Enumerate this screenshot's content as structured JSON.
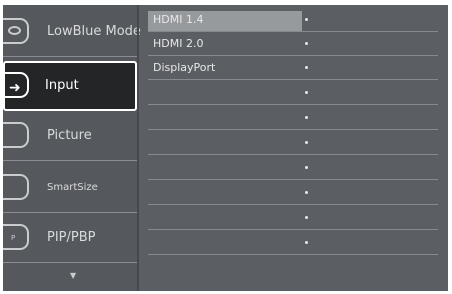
{
  "menu": [
    {
      "label": "LowBlue Mode",
      "icon": "eye-icon",
      "selected": false
    },
    {
      "label": "Input",
      "icon": "input-arrow-icon",
      "selected": true
    },
    {
      "label": "Picture",
      "icon": "picture-icon",
      "selected": false
    },
    {
      "label": "SmartSize",
      "icon": "smartsize-icon",
      "selected": false
    },
    {
      "label": "PIP/PBP",
      "icon": "pip-icon",
      "icon_text": "P",
      "selected": false
    }
  ],
  "more_indicator": "▼",
  "options": [
    {
      "label": "HDMI 1.4",
      "highlighted": true
    },
    {
      "label": "HDMI 2.0",
      "highlighted": false
    },
    {
      "label": "DisplayPort",
      "highlighted": false
    },
    {
      "label": "",
      "highlighted": false
    },
    {
      "label": "",
      "highlighted": false
    },
    {
      "label": "",
      "highlighted": false
    },
    {
      "label": "",
      "highlighted": false
    },
    {
      "label": "",
      "highlighted": false
    },
    {
      "label": "",
      "highlighted": false
    },
    {
      "label": "",
      "highlighted": false
    }
  ],
  "colors": {
    "panel": "#5b5f63",
    "selected_bg": "#232527",
    "highlight": "#979a9d"
  }
}
